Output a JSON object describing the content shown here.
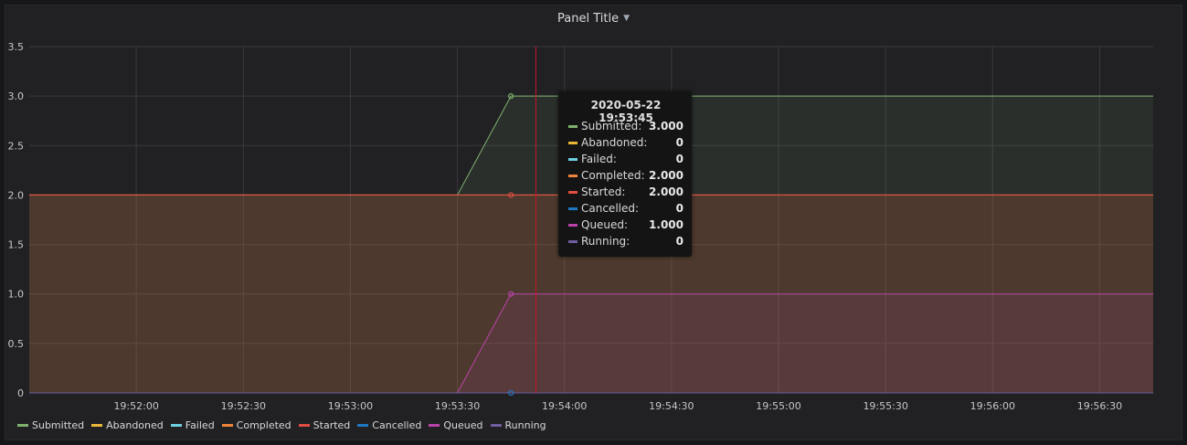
{
  "panel": {
    "title": "Panel Title"
  },
  "colors": {
    "Submitted": "#7eb26d",
    "Abandoned": "#eab839",
    "Failed": "#6ed0e0",
    "Completed": "#ef843c",
    "Started": "#e24d42",
    "Cancelled": "#1f78c1",
    "Queued": "#ba43a9",
    "Running": "#705da0"
  },
  "tooltip": {
    "time": "2020-05-22 19:53:45",
    "rows": [
      {
        "name": "Submitted:",
        "value": "3.000",
        "color": "#7eb26d"
      },
      {
        "name": "Abandoned:",
        "value": "0",
        "color": "#eab839"
      },
      {
        "name": "Failed:",
        "value": "0",
        "color": "#6ed0e0"
      },
      {
        "name": "Completed:",
        "value": "2.000",
        "color": "#ef843c"
      },
      {
        "name": "Started:",
        "value": "2.000",
        "color": "#e24d42"
      },
      {
        "name": "Cancelled:",
        "value": "0",
        "color": "#1f78c1"
      },
      {
        "name": "Queued:",
        "value": "1.000",
        "color": "#ba43a9"
      },
      {
        "name": "Running:",
        "value": "0",
        "color": "#705da0"
      }
    ]
  },
  "chart_data": {
    "type": "area",
    "title": "Panel Title",
    "x_unit": "seconds",
    "xlim": [
      "19:51:30",
      "19:56:45"
    ],
    "ylim": [
      0,
      3.5
    ],
    "yticks": [
      "0",
      "0.5",
      "1.0",
      "1.5",
      "2.0",
      "2.5",
      "3.0",
      "3.5"
    ],
    "xticks": [
      "19:52:00",
      "19:52:30",
      "19:53:00",
      "19:53:30",
      "19:54:00",
      "19:54:30",
      "19:55:00",
      "19:55:30",
      "19:56:00",
      "19:56:30"
    ],
    "grid": true,
    "legend_position": "bottom-left",
    "hover_time": "19:53:52",
    "series": [
      {
        "name": "Submitted",
        "color": "#7eb26d",
        "fill": true,
        "x": [
          "19:51:30",
          "19:53:30",
          "19:53:45",
          "19:56:45"
        ],
        "y": [
          2,
          2,
          3,
          3
        ]
      },
      {
        "name": "Abandoned",
        "color": "#eab839",
        "fill": true,
        "x": [
          "19:51:30",
          "19:56:45"
        ],
        "y": [
          0,
          0
        ]
      },
      {
        "name": "Failed",
        "color": "#6ed0e0",
        "fill": true,
        "x": [
          "19:51:30",
          "19:56:45"
        ],
        "y": [
          0,
          0
        ]
      },
      {
        "name": "Completed",
        "color": "#ef843c",
        "fill": true,
        "x": [
          "19:51:30",
          "19:56:45"
        ],
        "y": [
          2,
          2
        ]
      },
      {
        "name": "Started",
        "color": "#e24d42",
        "fill": true,
        "x": [
          "19:51:30",
          "19:56:45"
        ],
        "y": [
          2,
          2
        ]
      },
      {
        "name": "Cancelled",
        "color": "#1f78c1",
        "fill": true,
        "x": [
          "19:51:30",
          "19:56:45"
        ],
        "y": [
          0,
          0
        ]
      },
      {
        "name": "Queued",
        "color": "#ba43a9",
        "fill": true,
        "x": [
          "19:51:30",
          "19:53:30",
          "19:53:45",
          "19:56:45"
        ],
        "y": [
          0,
          0,
          1,
          1
        ]
      },
      {
        "name": "Running",
        "color": "#705da0",
        "fill": true,
        "x": [
          "19:51:30",
          "19:56:45"
        ],
        "y": [
          0,
          0
        ]
      }
    ],
    "hover_points": [
      {
        "series": "Submitted",
        "x": "19:53:45",
        "y": 3
      },
      {
        "series": "Started",
        "x": "19:53:45",
        "y": 2
      },
      {
        "series": "Queued",
        "x": "19:53:45",
        "y": 1
      },
      {
        "series": "Cancelled",
        "x": "19:53:45",
        "y": 0
      }
    ]
  }
}
